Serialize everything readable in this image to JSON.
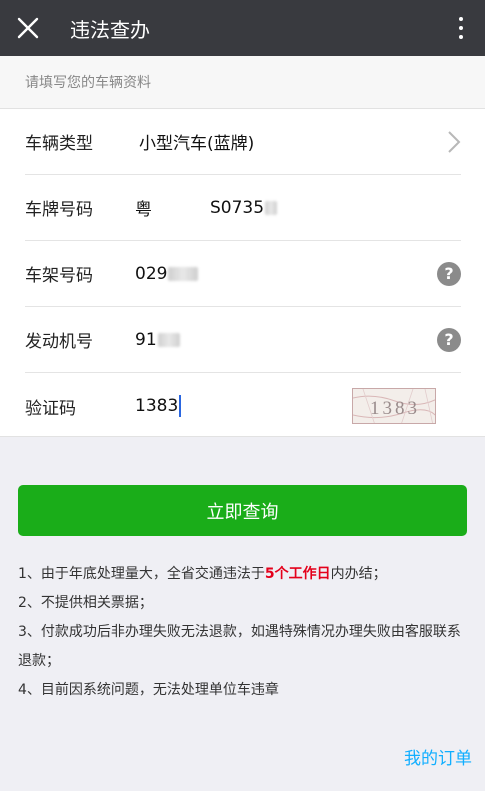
{
  "header": {
    "title": "违法查办",
    "close_icon": "close-icon",
    "more_icon": "more-vertical-icon",
    "background": "#393a3f"
  },
  "form_hint": "请填写您的车辆资料",
  "form": {
    "vehicle_type": {
      "label": "车辆类型",
      "value": "小型汽车(蓝牌)"
    },
    "plate": {
      "label": "车牌号码",
      "province": "粤",
      "number": "S0735"
    },
    "frame": {
      "label": "车架号码",
      "value": "029"
    },
    "engine": {
      "label": "发动机号",
      "value": "91"
    },
    "captcha": {
      "label": "验证码",
      "value": "1383",
      "image_text": "1383"
    }
  },
  "query_button": {
    "label": "立即查询",
    "color": "#1aad19"
  },
  "notes": [
    {
      "before": "1、由于年底处理量大，全省交通违法于",
      "highlight": "5个工作日",
      "after": "内办结；"
    },
    {
      "text": "2、不提供相关票据；"
    },
    {
      "text": "3、付款成功后非办理失败无法退款，如遇特殊情况办理失败由客服联系退款；"
    },
    {
      "text": "4、目前因系统问题，无法处理单位车违章"
    }
  ],
  "orders_link": {
    "label": "我的订单",
    "color": "#10aeff"
  },
  "highlight_color": "#e4001b"
}
